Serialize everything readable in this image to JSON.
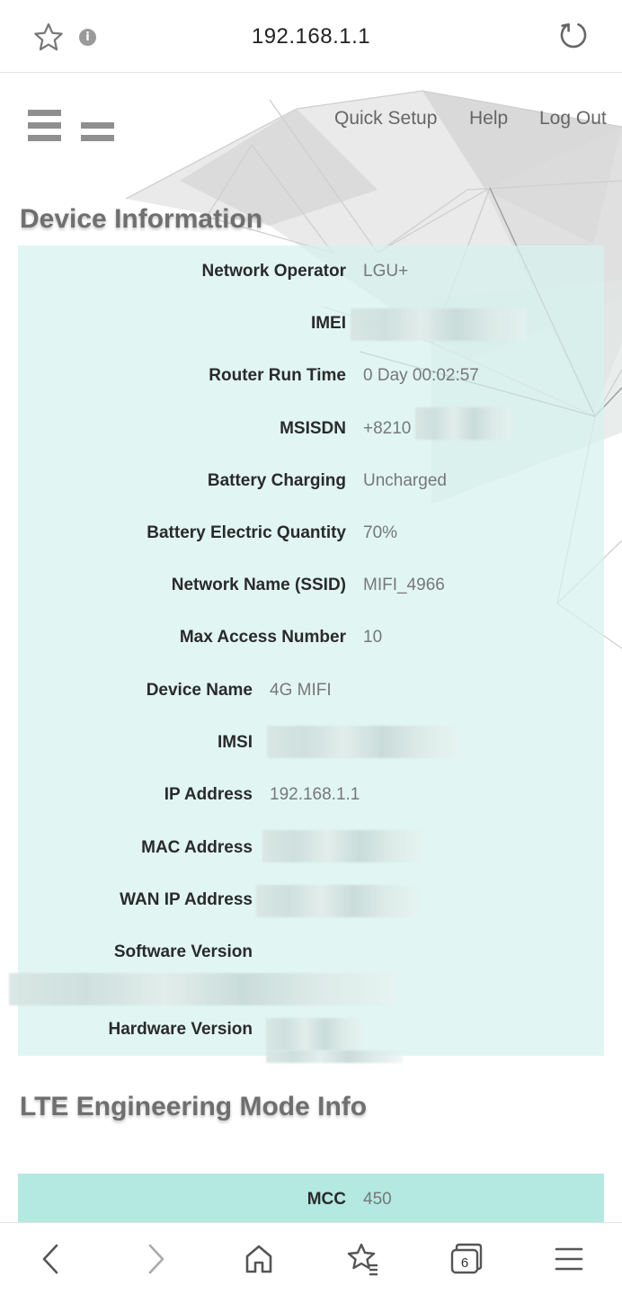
{
  "browser": {
    "url": "192.168.1.1",
    "tab_count": "6"
  },
  "header": {
    "nav": [
      "Quick Setup",
      "Help",
      "Log Out"
    ]
  },
  "device_info": {
    "title": "Device Information",
    "rows": [
      {
        "label": "Network Operator",
        "value": "LGU+"
      },
      {
        "label": "IMEI",
        "value": ""
      },
      {
        "label": "Router Run Time",
        "value": "0 Day 00:02:57"
      },
      {
        "label": "MSISDN",
        "value": "+8210"
      },
      {
        "label": "Battery Charging",
        "value": "Uncharged"
      },
      {
        "label": "Battery Electric Quantity",
        "value": "70%"
      },
      {
        "label": "Network Name (SSID)",
        "value": "MIFI_4966"
      },
      {
        "label": "Max Access Number",
        "value": "10"
      },
      {
        "label": "Device Name",
        "value": "4G MIFI"
      },
      {
        "label": "IMSI",
        "value": ""
      },
      {
        "label": "IP Address",
        "value": "192.168.1.1"
      },
      {
        "label": "MAC Address",
        "value": ""
      },
      {
        "label": "WAN IP Address",
        "value": ""
      },
      {
        "label": "Software Version",
        "value": ""
      },
      {
        "label": "Hardware Version",
        "value": ""
      }
    ]
  },
  "lte_info": {
    "title": "LTE Engineering Mode Info",
    "rows": [
      {
        "label": "MCC",
        "value": "450"
      }
    ]
  },
  "icons": {
    "address_bar": [
      "star-icon",
      "info-icon",
      "reload-icon"
    ],
    "header": [
      "hamburger-menu-icon",
      "collapse-menu-icon"
    ],
    "bottom_bar": [
      "back-icon",
      "forward-icon",
      "home-icon",
      "bookmarks-icon",
      "tabs-icon",
      "menu-icon"
    ]
  },
  "colors": {
    "panel_bg": "#d6f2ee",
    "highlight_row": "#b3e9e1",
    "section_title": "#6f6f6f"
  }
}
